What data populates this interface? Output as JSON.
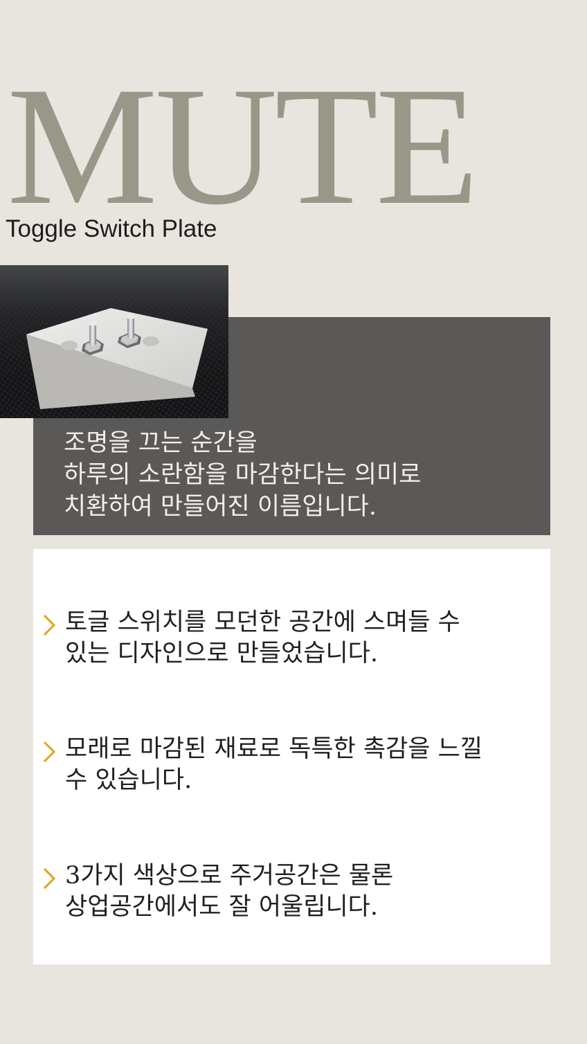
{
  "brand": {
    "title": "MUTE",
    "subtitle": "Toggle Switch Plate"
  },
  "photo": {
    "description_icon": "toggle-switch-plate-photo"
  },
  "intro": {
    "lines": [
      "조명을 끄는 순간을",
      "하루의 소란함을 마감한다는 의미로",
      "치환하여 만들어진 이름입니다."
    ]
  },
  "features": [
    {
      "icon": "chevron-right-icon",
      "lines": [
        "토글 스위치를 모던한 공간에 스며들 수",
        "있는 디자인으로 만들었습니다."
      ]
    },
    {
      "icon": "chevron-right-icon",
      "lines": [
        "모래로 마감된 재료로 독특한 촉감을 느낄",
        "수 있습니다."
      ]
    },
    {
      "icon": "chevron-right-icon",
      "lines": [
        "3가지 색상으로 주거공간은 물론",
        "상업공간에서도 잘 어울립니다."
      ]
    }
  ],
  "colors": {
    "background": "#e8e5df",
    "title": "#999788",
    "panel": "#5b5957",
    "accent": "#e1a92a",
    "card": "#ffffff"
  }
}
